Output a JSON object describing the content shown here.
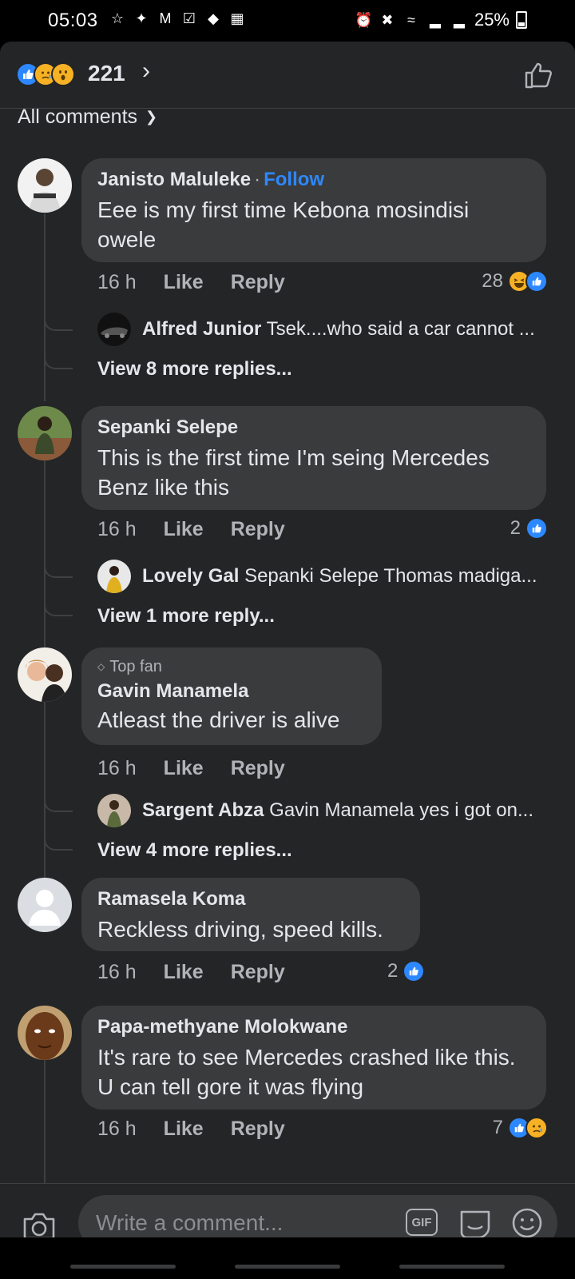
{
  "status_bar": {
    "time": "05:03",
    "battery": "25%",
    "left_icons": [
      "notification-icon",
      "twitter-icon",
      "gmail-icon",
      "check-icon",
      "diamond-icon",
      "image-icon"
    ],
    "right_icons": [
      "alarm-icon",
      "mute-icon",
      "wifi-icon",
      "signal-icon",
      "signal-icon"
    ]
  },
  "header": {
    "reaction_icons": [
      "like",
      "sad",
      "wow"
    ],
    "reaction_count": "221",
    "filter_label": "All comments"
  },
  "comments": [
    {
      "author": "Janisto Maluleke",
      "follow_label": "Follow",
      "text": "Eee is my first time Kebona mosindisi owele",
      "time": "16 h",
      "like_label": "Like",
      "reply_label": "Reply",
      "reaction_count": "28",
      "reaction_types": [
        "haha",
        "like"
      ],
      "reply_preview": {
        "author": "Alfred Junior",
        "text": "Tsek....who said a car cannot ..."
      },
      "view_more": "View 8 more replies..."
    },
    {
      "author": "Sepanki Selepe",
      "text": "This is the first time I'm seing Mercedes Benz like this",
      "time": "16 h",
      "like_label": "Like",
      "reply_label": "Reply",
      "reaction_count": "2",
      "reaction_types": [
        "like"
      ],
      "reply_preview": {
        "author": "Lovely Gal",
        "text": "Sepanki Selepe Thomas madiga..."
      },
      "view_more": "View 1 more reply..."
    },
    {
      "badge": "Top fan",
      "author": "Gavin Manamela",
      "text": "Atleast the driver is alive",
      "time": "16 h",
      "like_label": "Like",
      "reply_label": "Reply",
      "reply_preview": {
        "author": "Sargent Abza",
        "text": "Gavin Manamela yes i got on..."
      },
      "view_more": "View 4 more replies..."
    },
    {
      "author": "Ramasela Koma",
      "text": "Reckless driving, speed kills.",
      "time": "16 h",
      "like_label": "Like",
      "reply_label": "Reply",
      "reaction_count": "2",
      "reaction_types": [
        "like"
      ]
    },
    {
      "author": "Papa-methyane Molokwane",
      "text": "It's rare to see Mercedes crashed like this. U can tell gore it was flying",
      "time": "16 h",
      "like_label": "Like",
      "reply_label": "Reply",
      "reaction_count": "7",
      "reaction_types": [
        "like",
        "sad"
      ]
    }
  ],
  "composer": {
    "placeholder": "Write a comment...",
    "gif_label": "GIF"
  },
  "colors": {
    "background": "#242526",
    "bubble": "#3a3b3c",
    "accent_blue": "#2d88ff",
    "text_primary": "#e4e6eb",
    "text_secondary": "#b0b3b8"
  }
}
